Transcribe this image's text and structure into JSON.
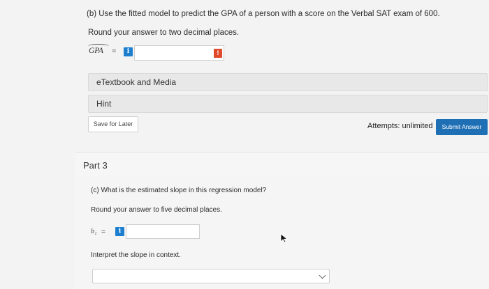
{
  "part_b": {
    "question": "(b) Use the fitted model to predict the GPA of a person with a score on the Verbal SAT exam of 600.",
    "round_instruction": "Round your answer to two decimal places.",
    "variable_label": "GPA",
    "equals": "=",
    "info_icon": "i",
    "alert_icon": "!",
    "answer_value": ""
  },
  "resources": {
    "etextbook_label": "eTextbook and Media",
    "hint_label": "Hint"
  },
  "actions": {
    "save_label": "Save for Later",
    "attempts_text": "Attempts: unlimited",
    "submit_label": "Submit Answer"
  },
  "part_3": {
    "title": "Part 3",
    "question": "(c) What is the estimated slope in this regression model?",
    "round_instruction": "Round your answer to five decimal places.",
    "variable_label": "b₁",
    "equals": "=",
    "info_icon": "i",
    "answer_value": "",
    "interpret_prompt": "Interpret the slope in context.",
    "interpret_selected": ""
  },
  "colors": {
    "info_blue": "#1e7fcf",
    "alert_red": "#e04a2a",
    "submit_blue": "#1f6fb5"
  }
}
